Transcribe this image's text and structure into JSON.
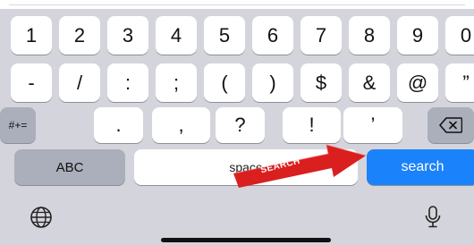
{
  "keyboard": {
    "row1": [
      "1",
      "2",
      "3",
      "4",
      "5",
      "6",
      "7",
      "8",
      "9",
      "0"
    ],
    "row2": [
      "-",
      "/",
      ":",
      ";",
      "(",
      ")",
      "$",
      "&",
      "@",
      "”"
    ],
    "row3": {
      "symbols_toggle": "#+=",
      "keys": [
        ".",
        ",",
        "?",
        "!",
        "’"
      ],
      "delete_icon": "backspace-icon"
    },
    "row4": {
      "abc_label": "ABC",
      "space_label": "space",
      "search_label": "search"
    },
    "bottom": {
      "globe_icon": "globe-icon",
      "mic_icon": "microphone-icon"
    }
  },
  "annotation": {
    "label": "SEARCH",
    "color": "#d9201f"
  },
  "colors": {
    "keyboard_bg": "#d4d5dc",
    "key_bg": "#ffffff",
    "dark_key_bg": "#abafbb",
    "search_key_bg": "#1a82fb"
  }
}
